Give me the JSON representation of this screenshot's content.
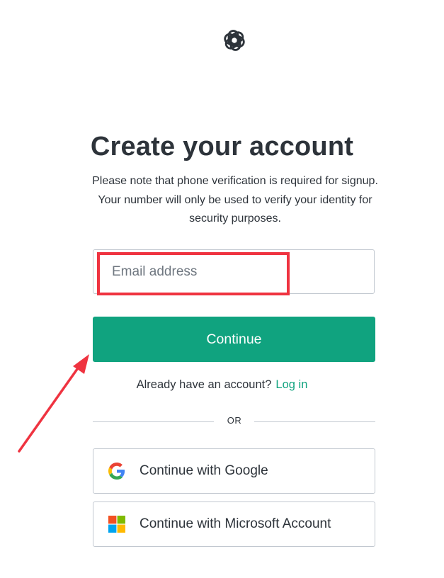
{
  "logo": {
    "icon": "openai-logo-icon"
  },
  "header": {
    "title": "Create your account",
    "subtitle": "Please note that phone verification is required for signup. Your number will only be used to verify your identity for security purposes."
  },
  "form": {
    "email_placeholder": "Email address",
    "email_value": "",
    "continue_label": "Continue"
  },
  "login": {
    "prompt": "Already have an account?",
    "link_label": "Log in"
  },
  "divider": {
    "label": "OR"
  },
  "social": [
    {
      "label": "Continue with Google",
      "icon": "google-icon"
    },
    {
      "label": "Continue with Microsoft Account",
      "icon": "microsoft-icon"
    }
  ],
  "annotation": {
    "highlight_color": "#ef3340",
    "arrow_color": "#ef3340"
  },
  "colors": {
    "accent": "#10a37f",
    "text": "#2d333a",
    "border": "#c2c8d0"
  }
}
